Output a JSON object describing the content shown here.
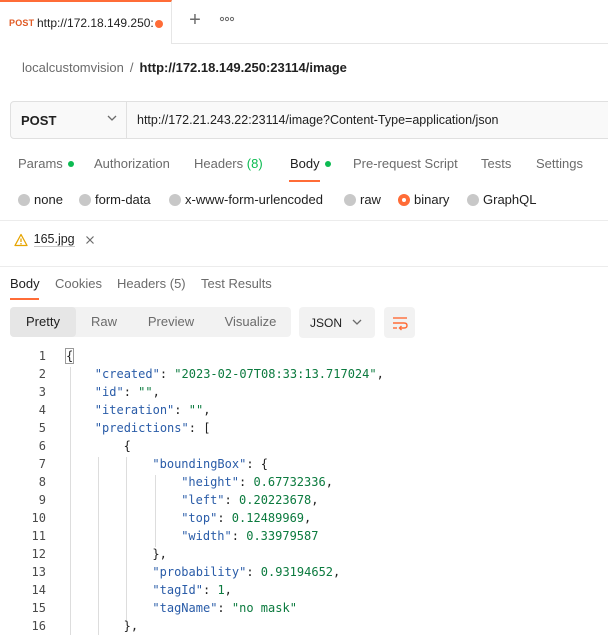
{
  "tab": {
    "method": "POST",
    "name": "http://172.18.149.250:"
  },
  "breadcrumb": {
    "parent": "localcustomvision",
    "separator": "/",
    "current": "http://172.18.149.250:23114/image"
  },
  "request": {
    "method": "POST",
    "url": "http://172.21.243.22:23114/image?Content-Type=application/json"
  },
  "request_tabs": [
    {
      "label": "Params"
    },
    {
      "label": "Authorization"
    },
    {
      "label": "Headers",
      "count": "(8)"
    },
    {
      "label": "Body"
    },
    {
      "label": "Pre-request Script"
    },
    {
      "label": "Tests"
    },
    {
      "label": "Settings"
    }
  ],
  "body_types": [
    "none",
    "form-data",
    "x-www-form-urlencoded",
    "raw",
    "binary",
    "GraphQL"
  ],
  "body_selected": "binary",
  "file": {
    "name": "165.jpg"
  },
  "response_tabs": [
    "Body",
    "Cookies",
    "Headers (5)",
    "Test Results"
  ],
  "view_modes": [
    "Pretty",
    "Raw",
    "Preview",
    "Visualize"
  ],
  "format": "JSON",
  "code_lines": [
    {
      "n": "1",
      "text": "{"
    },
    {
      "n": "2",
      "text": "\"created\": \"2023-02-07T08:33:13.717024\","
    },
    {
      "n": "3",
      "text": "\"id\": \"\","
    },
    {
      "n": "4",
      "text": "\"iteration\": \"\","
    },
    {
      "n": "5",
      "text": "\"predictions\": ["
    },
    {
      "n": "6",
      "text": "{"
    },
    {
      "n": "7",
      "text": "\"boundingBox\": {"
    },
    {
      "n": "8",
      "text": "\"height\": 0.67732336,"
    },
    {
      "n": "9",
      "text": "\"left\": 0.20223678,"
    },
    {
      "n": "10",
      "text": "\"top\": 0.12489969,"
    },
    {
      "n": "11",
      "text": "\"width\": 0.33979587"
    },
    {
      "n": "12",
      "text": "},"
    },
    {
      "n": "13",
      "text": "\"probability\": 0.93194652,"
    },
    {
      "n": "14",
      "text": "\"tagId\": 1,"
    },
    {
      "n": "15",
      "text": "\"tagName\": \"no mask\""
    },
    {
      "n": "16",
      "text": "},"
    }
  ],
  "colors": {
    "accent": "#ff6c37",
    "green": "#0cbb52",
    "key": "#2a5ca8",
    "value": "#0b7a3e"
  }
}
